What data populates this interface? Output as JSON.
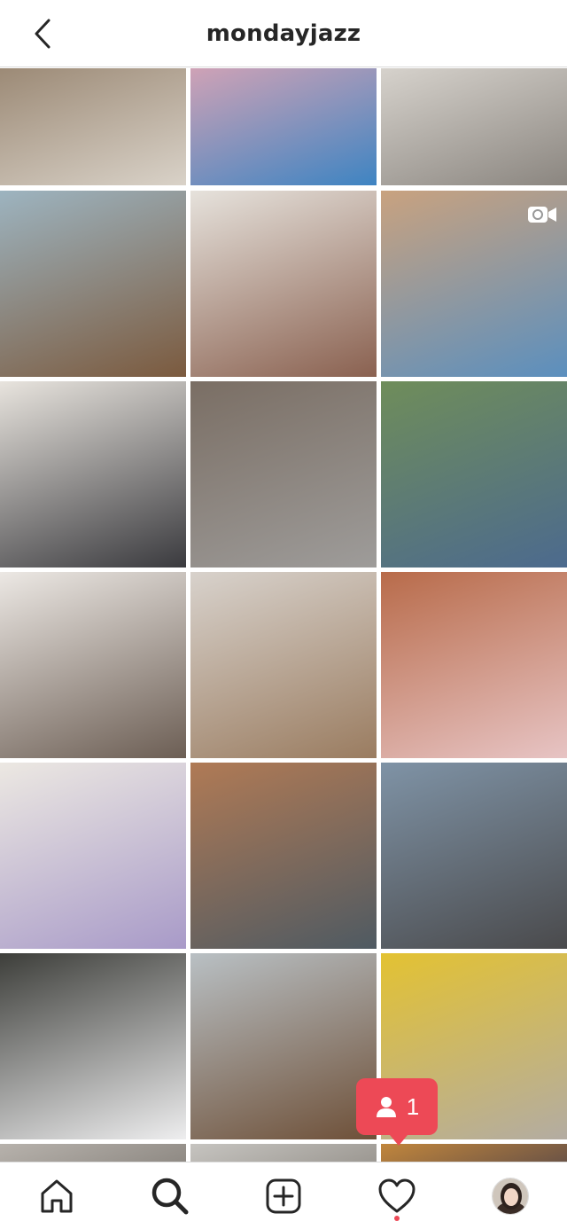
{
  "header": {
    "title": "mondayjazz",
    "back_icon": "chevron-left-icon"
  },
  "grid": {
    "tiles": [
      {
        "top": "#9c8a76",
        "bottom": "#d9d2c8"
      },
      {
        "top": "#cfa2b6",
        "bottom": "#3e84c2"
      },
      {
        "top": "#d6d2cc",
        "bottom": "#8b8680"
      },
      {
        "top": "#9db4c0",
        "bottom": "#7b5a3e"
      },
      {
        "top": "#e6e2dc",
        "bottom": "#8a6150"
      },
      {
        "top": "#c9a27f",
        "bottom": "#5b8fbe"
      },
      {
        "top": "#e8e4de",
        "bottom": "#3a3a3e"
      },
      {
        "top": "#7a6e64",
        "bottom": "#9e9c9a"
      },
      {
        "top": "#6f8d5a",
        "bottom": "#4c6a8e"
      },
      {
        "top": "#ece8e4",
        "bottom": "#6c5e54"
      },
      {
        "top": "#d8d2cc",
        "bottom": "#9a7c60"
      },
      {
        "top": "#b86b4a",
        "bottom": "#e7c4c4"
      },
      {
        "top": "#ece8e2",
        "bottom": "#a89ac8"
      },
      {
        "top": "#b07a55",
        "bottom": "#4f5a62"
      },
      {
        "top": "#7f93a6",
        "bottom": "#4a4a4c"
      },
      {
        "top": "#3d3e3a",
        "bottom": "#eeeeef"
      },
      {
        "top": "#b9c0c4",
        "bottom": "#6e5038"
      },
      {
        "top": "#e3c232",
        "bottom": "#b3aca2"
      },
      {
        "top": "#b7b2ac",
        "bottom": "#8f8a84"
      },
      {
        "top": "#c6c4c0",
        "bottom": "#9c9892"
      },
      {
        "top": "#c1863c",
        "bottom": "#6c5446"
      }
    ]
  },
  "video_badge_icon": "video-camera-icon",
  "notification": {
    "icon": "person-icon",
    "count": "1",
    "color": "#ed4956"
  },
  "tabbar": {
    "items": [
      {
        "icon": "home-icon"
      },
      {
        "icon": "search-icon"
      },
      {
        "icon": "add-post-icon"
      },
      {
        "icon": "heart-icon"
      },
      {
        "icon": "profile-avatar"
      }
    ]
  }
}
